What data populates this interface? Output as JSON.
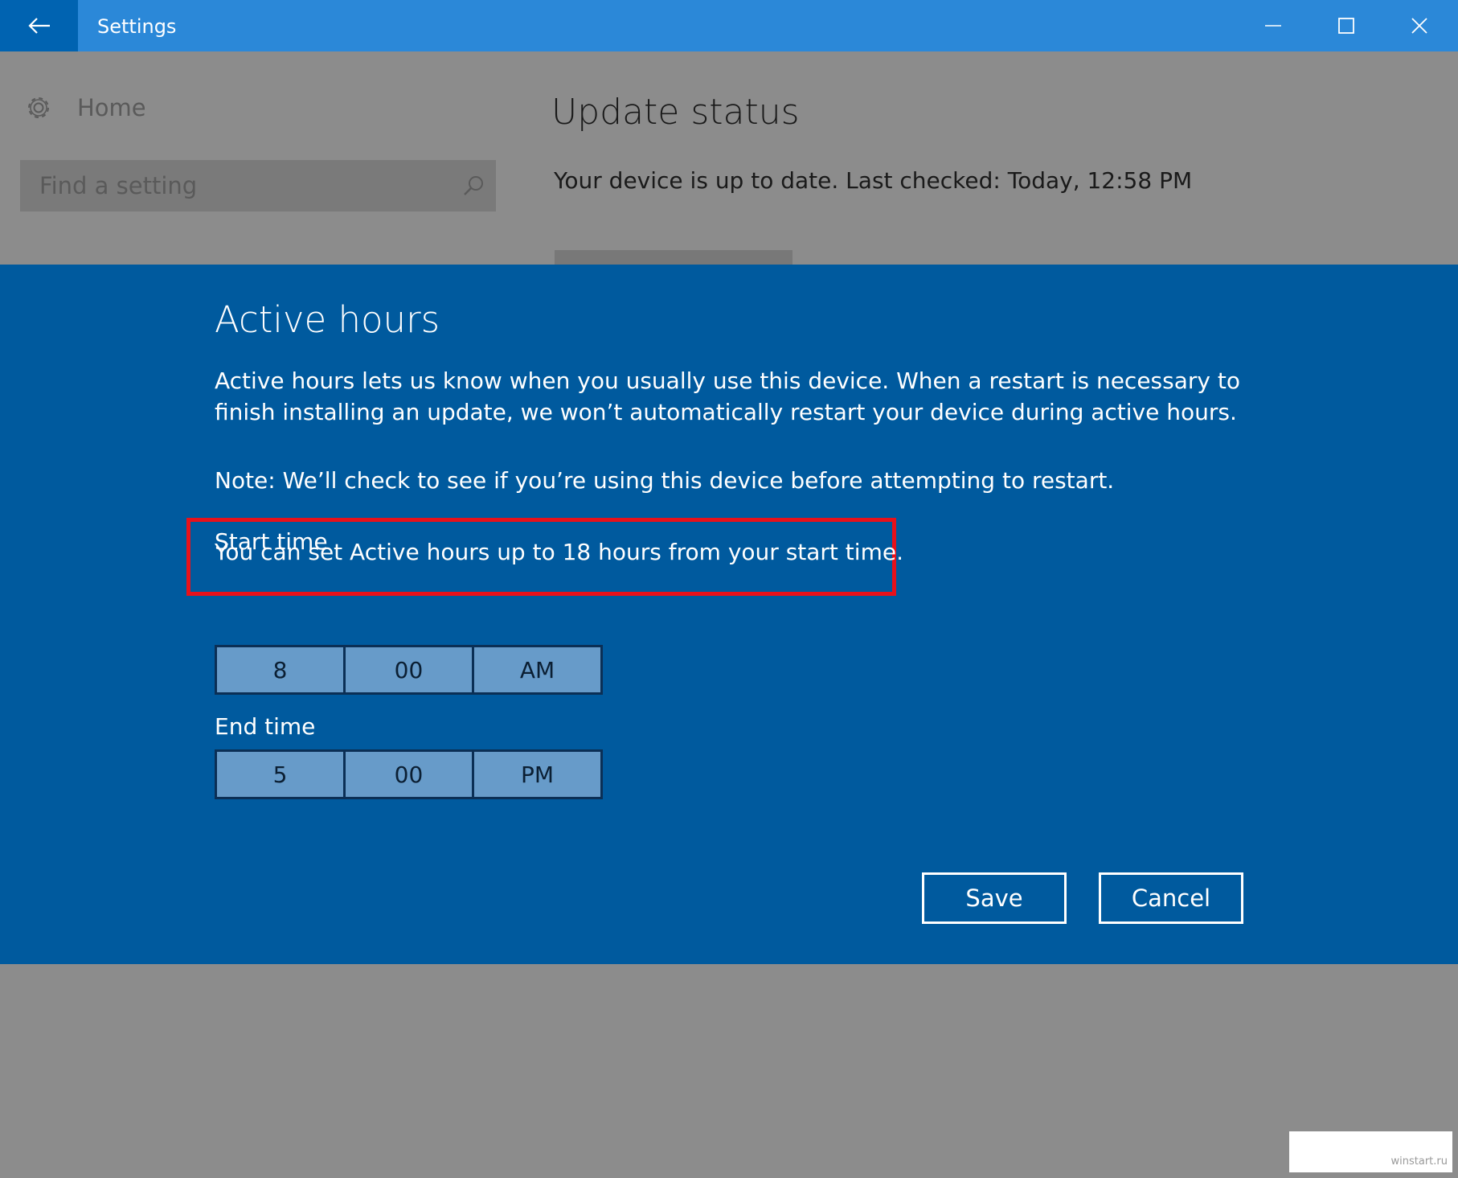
{
  "window": {
    "title": "Settings"
  },
  "sidebar": {
    "home_label": "Home",
    "search_placeholder": "Find a setting"
  },
  "main": {
    "title": "Update status",
    "status_text": "Your device is up to date. Last checked: Today, 12:58 PM"
  },
  "dialog": {
    "title": "Active hours",
    "description": "Active hours lets us know when you usually use this device. When a restart is necessary to finish installing an update, we won’t automatically restart your device during active hours.",
    "note": "Note: We’ll check to see if you’re using this device before attempting to restart.",
    "limit_text": "You can set Active hours up to 18 hours from your start time.",
    "start_time": {
      "label": "Start time",
      "hour": "8",
      "minute": "00",
      "period": "AM"
    },
    "end_time": {
      "label": "End time",
      "hour": "5",
      "minute": "00",
      "period": "PM"
    },
    "save_label": "Save",
    "cancel_label": "Cancel"
  },
  "watermark": "winstart.ru",
  "icons": {
    "back": "back-arrow-icon",
    "minimize": "minimize-icon",
    "maximize": "maximize-icon",
    "close": "close-icon",
    "home": "gear-icon",
    "search": "search-icon"
  },
  "colors": {
    "titlebar": "#2b88d8",
    "back_button": "#0063b1",
    "dialog_background": "#005a9e",
    "overlay": "#8c8c8c",
    "highlight": "#e8111b",
    "time_segment": "#679bc9"
  }
}
